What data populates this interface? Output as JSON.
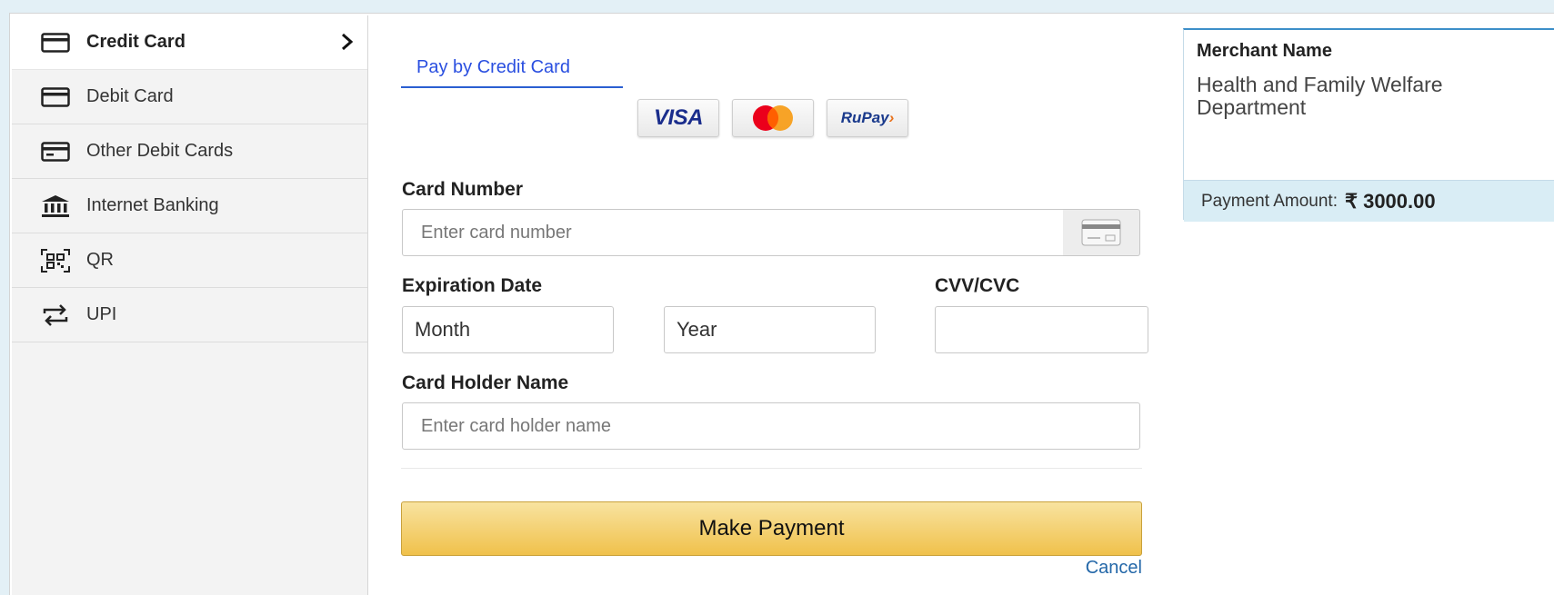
{
  "sidebar": {
    "items": [
      {
        "label": "Credit Card",
        "icon": "credit-card-icon",
        "active": true
      },
      {
        "label": "Debit Card",
        "icon": "debit-card-icon"
      },
      {
        "label": "Other Debit Cards",
        "icon": "other-card-icon"
      },
      {
        "label": "Internet Banking",
        "icon": "bank-icon"
      },
      {
        "label": "QR",
        "icon": "qr-icon"
      },
      {
        "label": "UPI",
        "icon": "upi-icon"
      }
    ]
  },
  "form": {
    "tab_label": "Pay by Credit Card",
    "logos": {
      "visa": "VISA",
      "rupay": "RuPay"
    },
    "card_number": {
      "label": "Card Number",
      "placeholder": "Enter card number"
    },
    "expiration": {
      "label": "Expiration Date",
      "month": "Month",
      "year": "Year"
    },
    "cvv": {
      "label": "CVV/CVC",
      "value": ""
    },
    "holder": {
      "label": "Card Holder Name",
      "placeholder": "Enter card holder name"
    },
    "submit_label": "Make Payment",
    "cancel_label": "Cancel"
  },
  "merchant": {
    "title": "Merchant Name",
    "name": "Health and Family Welfare Department",
    "amount_label": "Payment Amount:",
    "amount_value": "₹ 3000.00"
  },
  "colors": {
    "accent": "#2a5fd1",
    "button": "#f0c14b",
    "panel": "#d9edf5"
  }
}
